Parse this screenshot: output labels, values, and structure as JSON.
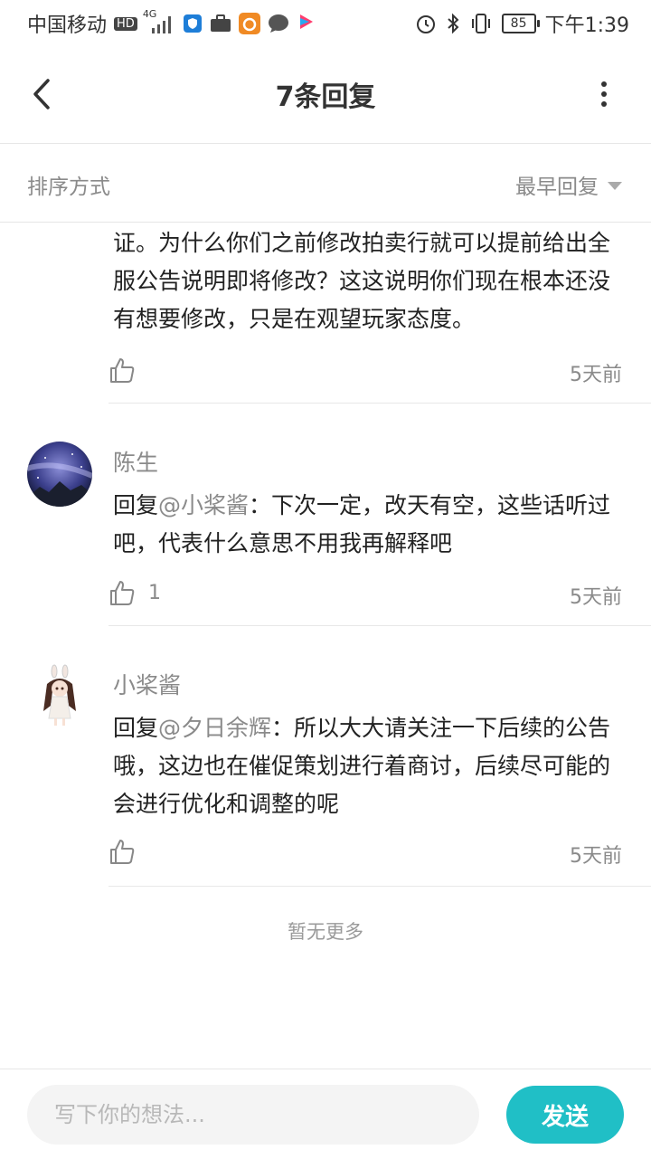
{
  "status_bar": {
    "carrier": "中国移动",
    "hd": "HD",
    "network": "4G",
    "battery": "85",
    "time": "下午1:39"
  },
  "header": {
    "title": "7条回复"
  },
  "sort": {
    "label": "排序方式",
    "selected": "最早回复"
  },
  "replies": [
    {
      "name": "",
      "text": "证。为什么你们之前修改拍卖行就可以提前给出全服公告说明即将修改？这这说明你们现在根本还没有想要修改，只是在观望玩家态度。",
      "likes": "",
      "time": "5天前"
    },
    {
      "name": "陈生",
      "reply_prefix": "回复",
      "reply_to": "@小桨酱",
      "text": "：下次一定，改天有空，这些话听过吧，代表什么意思不用我再解释吧",
      "likes": "1",
      "time": "5天前"
    },
    {
      "name": "小桨酱",
      "reply_prefix": "回复",
      "reply_to": "@夕日余辉",
      "text": "：所以大大请关注一下后续的公告哦，这边也在催促策划进行着商讨，后续尽可能的会进行优化和调整的呢",
      "likes": "",
      "time": "5天前"
    }
  ],
  "footer_note": "暂无更多",
  "input": {
    "placeholder": "写下你的想法...",
    "send_label": "发送"
  },
  "colors": {
    "accent": "#20bfc6",
    "muted_text": "#8a8a8a"
  }
}
